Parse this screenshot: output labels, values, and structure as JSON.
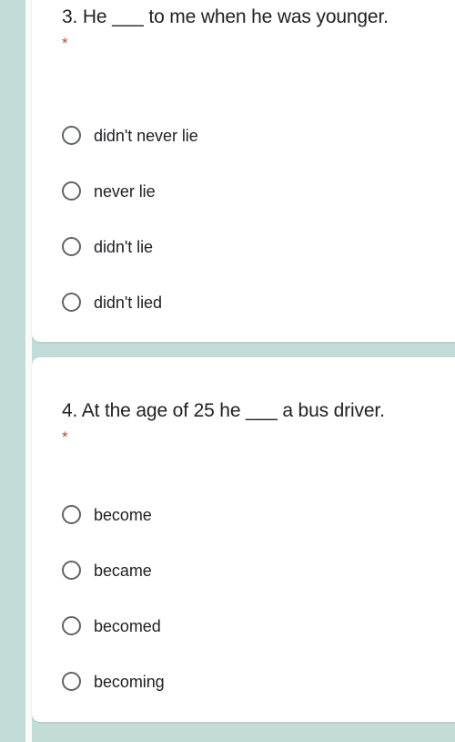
{
  "theme": {
    "background_color": "#c3dcd8",
    "card_color": "#ffffff",
    "text_color": "#202124",
    "required_marker_color": "#b94a42",
    "radio_outline_color": "#5f6368"
  },
  "questions": [
    {
      "text": "3. He ___ to me when he was younger.",
      "required_marker": "*",
      "options": [
        {
          "label": "didn't never lie",
          "selected": false
        },
        {
          "label": "never lie",
          "selected": false
        },
        {
          "label": "didn't lie",
          "selected": false
        },
        {
          "label": "didn't lied",
          "selected": false
        }
      ]
    },
    {
      "text": "4. At the age of 25 he ___ a bus driver.",
      "required_marker": "*",
      "options": [
        {
          "label": "become",
          "selected": false
        },
        {
          "label": "became",
          "selected": false
        },
        {
          "label": "becomed",
          "selected": false
        },
        {
          "label": "becoming",
          "selected": false
        }
      ]
    }
  ]
}
